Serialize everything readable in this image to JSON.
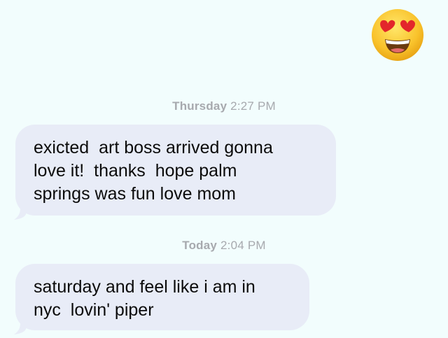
{
  "header": {
    "emoji_icon": "heart-eyes-emoji"
  },
  "thread": [
    {
      "timestamp_day": "Thursday",
      "timestamp_time": "2:27 PM",
      "lines": [
        "exicted  art boss arrived gonna",
        "love it!  thanks  hope palm",
        "springs was fun love mom"
      ]
    },
    {
      "timestamp_day": "Today",
      "timestamp_time": "2:04 PM",
      "lines": [
        "saturday and feel like i am in",
        "nyc  lovin' piper"
      ]
    }
  ],
  "colors": {
    "background": "#f2fdfd",
    "bubble": "#e8ecf7",
    "timestamp": "#a7a9ae"
  }
}
